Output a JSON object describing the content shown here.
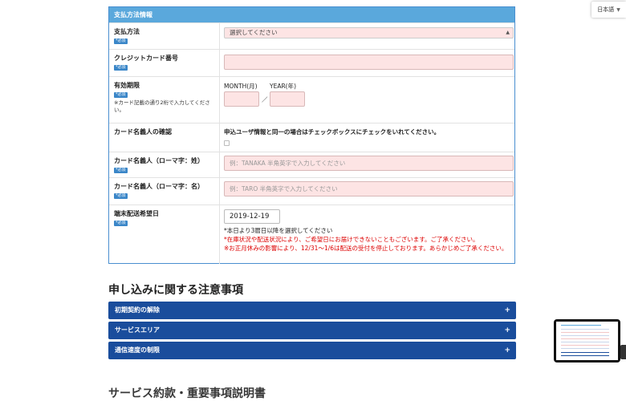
{
  "language": {
    "label": "日本語",
    "caret": "▼"
  },
  "panel": {
    "title": "支払方法情報",
    "required_badge": "*必須",
    "rows": {
      "payment_method": {
        "label": "支払方法",
        "select_value": "選択してください"
      },
      "card_number": {
        "label": "クレジットカード番号"
      },
      "expiry": {
        "label": "有効期限",
        "note": "※カード記載の通り2桁で入力してください。",
        "month_label": "MONTH(月)",
        "year_label": "YEAR(年)",
        "separator": "／"
      },
      "holder_confirm": {
        "label": "カード名義人の確認",
        "text": "申込ユーザ情報と同一の場合はチェックボックスにチェックをいれてください。"
      },
      "holder_last": {
        "label": "カード名義人（ローマ字：姓）",
        "placeholder": "例：TANAKA 半角英字で入力してください"
      },
      "holder_first": {
        "label": "カード名義人（ローマ字：名）",
        "placeholder": "例：TARO 半角英字で入力してください"
      },
      "delivery": {
        "label": "端末配送希望日",
        "date_value": "2019-12-19",
        "note1": "*本日より3暦日以降を選択してください",
        "note2": "*在庫状況や配送状況により、ご希望日にお届けできないこともございます。ご了承ください。",
        "note3": "※お正月休みの影響により、12/31〜1/6は配送の受付を停止しております。あらかじめご了承ください。"
      }
    }
  },
  "notes_section": {
    "title": "申し込みに関する注意事項",
    "items": [
      {
        "label": "初期契約の解除",
        "icon": "+"
      },
      {
        "label": "サービスエリア",
        "icon": "+"
      },
      {
        "label": "通信速度の制限",
        "icon": "+"
      }
    ]
  },
  "next_section": {
    "title": "サービス約款・重要事項説明書"
  }
}
